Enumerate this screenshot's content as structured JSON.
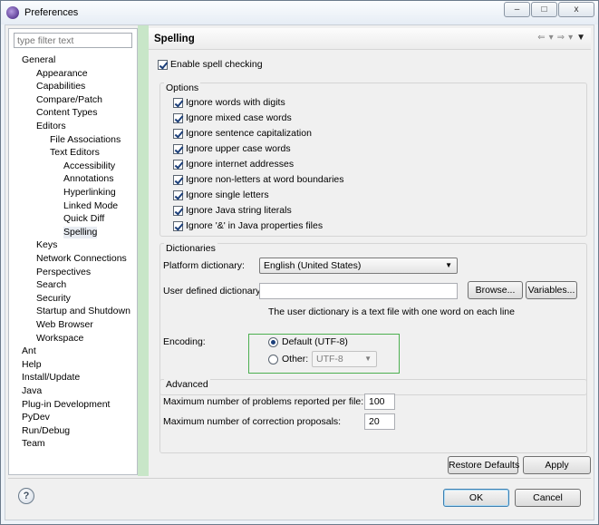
{
  "window": {
    "title": "Preferences",
    "buttons": [
      "–",
      "□",
      "x"
    ]
  },
  "filter": {
    "placeholder": "type filter text"
  },
  "tree": [
    {
      "label": "General",
      "depth": 0
    },
    {
      "label": "Appearance",
      "depth": 1
    },
    {
      "label": "Capabilities",
      "depth": 1
    },
    {
      "label": "Compare/Patch",
      "depth": 1
    },
    {
      "label": "Content Types",
      "depth": 1
    },
    {
      "label": "Editors",
      "depth": 1
    },
    {
      "label": "File Associations",
      "depth": 2
    },
    {
      "label": "Text Editors",
      "depth": 2
    },
    {
      "label": "Accessibility",
      "depth": 3
    },
    {
      "label": "Annotations",
      "depth": 3
    },
    {
      "label": "Hyperlinking",
      "depth": 3
    },
    {
      "label": "Linked Mode",
      "depth": 3
    },
    {
      "label": "Quick Diff",
      "depth": 3
    },
    {
      "label": "Spelling",
      "depth": 3,
      "selected": true
    },
    {
      "label": "Keys",
      "depth": 1
    },
    {
      "label": "Network Connections",
      "depth": 1
    },
    {
      "label": "Perspectives",
      "depth": 1
    },
    {
      "label": "Search",
      "depth": 1
    },
    {
      "label": "Security",
      "depth": 1
    },
    {
      "label": "Startup and Shutdown",
      "depth": 1
    },
    {
      "label": "Web Browser",
      "depth": 1
    },
    {
      "label": "Workspace",
      "depth": 1
    },
    {
      "label": "Ant",
      "depth": 0
    },
    {
      "label": "Help",
      "depth": 0
    },
    {
      "label": "Install/Update",
      "depth": 0
    },
    {
      "label": "Java",
      "depth": 0
    },
    {
      "label": "Plug-in Development",
      "depth": 0
    },
    {
      "label": "PyDev",
      "depth": 0
    },
    {
      "label": "Run/Debug",
      "depth": 0
    },
    {
      "label": "Team",
      "depth": 0
    }
  ],
  "page": {
    "title": "Spelling",
    "enable_spell_checking": {
      "label": "Enable spell checking",
      "checked": true
    },
    "options": {
      "title": "Options",
      "items": [
        {
          "label": "Ignore words with digits",
          "checked": true
        },
        {
          "label": "Ignore mixed case words",
          "checked": true
        },
        {
          "label": "Ignore sentence capitalization",
          "checked": true
        },
        {
          "label": "Ignore upper case words",
          "checked": true
        },
        {
          "label": "Ignore internet addresses",
          "checked": true
        },
        {
          "label": "Ignore non-letters at word boundaries",
          "checked": true
        },
        {
          "label": "Ignore single letters",
          "checked": true
        },
        {
          "label": "Ignore Java string literals",
          "checked": true
        },
        {
          "label": "Ignore '&' in Java properties files",
          "checked": true
        }
      ]
    },
    "dictionaries": {
      "title": "Dictionaries",
      "platform_label": "Platform dictionary:",
      "platform_value": "English (United States)",
      "user_label": "User defined dictionary:",
      "user_value": "",
      "browse_label": "Browse...",
      "variables_label": "Variables...",
      "hint": "The user dictionary is a text file with one word on each line",
      "encoding_label": "Encoding:",
      "default_label": "Default (UTF-8)",
      "other_label": "Other:",
      "other_value": "UTF-8",
      "selected_encoding": "default"
    },
    "advanced": {
      "title": "Advanced",
      "max_problems_label": "Maximum number of problems reported per file:",
      "max_problems_value": "100",
      "max_proposals_label": "Maximum number of correction proposals:",
      "max_proposals_value": "20"
    },
    "restore_defaults_label": "Restore Defaults",
    "apply_label": "Apply"
  },
  "footer": {
    "ok_label": "OK",
    "cancel_label": "Cancel",
    "help_glyph": "?"
  },
  "colors": {
    "sash": "#c8e6c8",
    "encoding_highlight": "#4caf50",
    "selection": "#e8ecf2"
  }
}
